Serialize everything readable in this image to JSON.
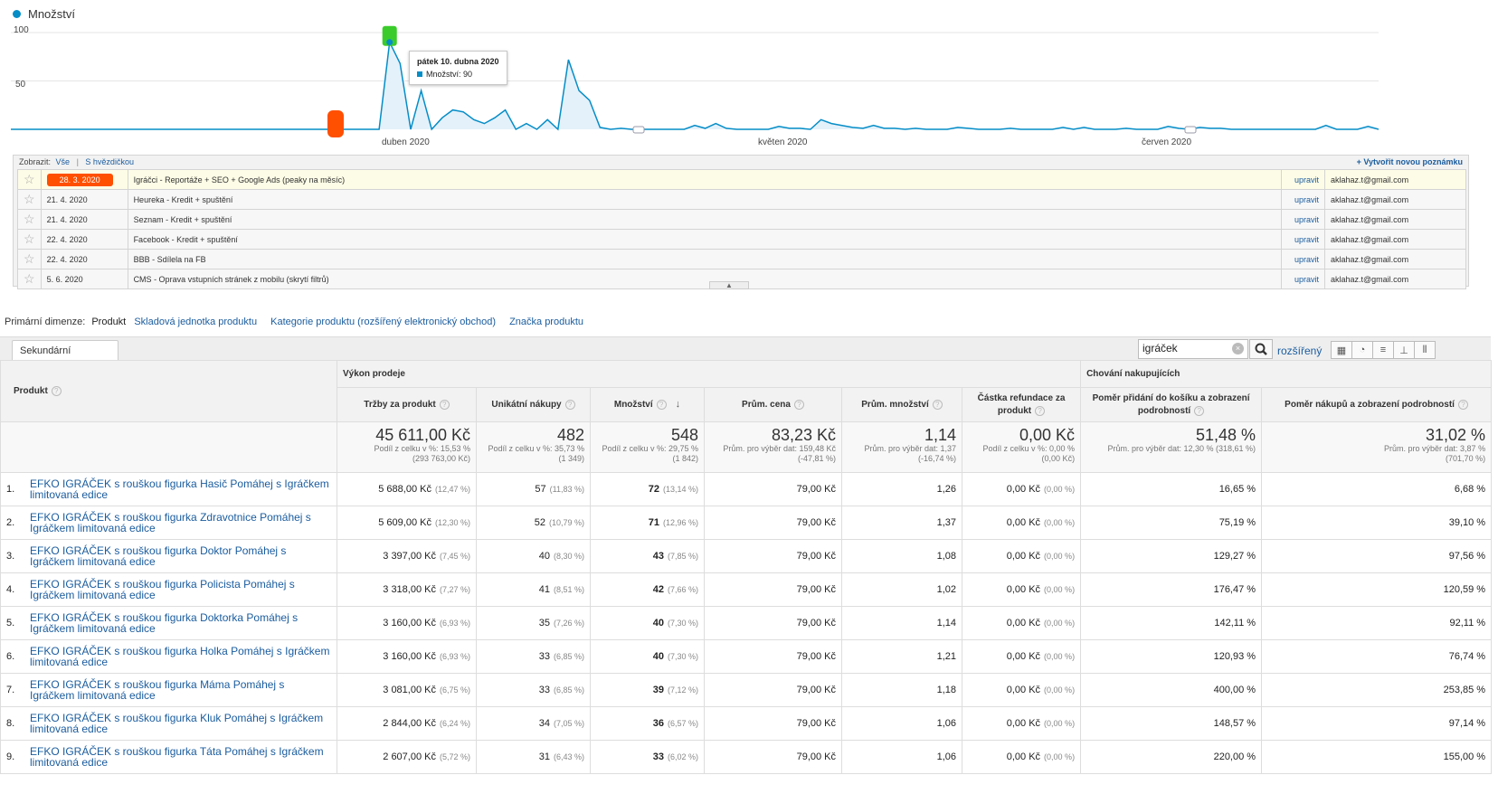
{
  "chart": {
    "legend_label": "Množství",
    "colors": {
      "series": "#058dc7",
      "area": "#e4f1fa",
      "marker_green": "#3bcc2b",
      "marker_orange": "#ff4f00"
    },
    "y_ticks": [
      "100",
      "50"
    ],
    "x_labels": [
      "duben 2020",
      "květen 2020",
      "červen 2020"
    ],
    "tooltip": {
      "date": "pátek 10. dubna 2020",
      "label": "Množství: 90"
    }
  },
  "chart_data": {
    "type": "area",
    "title": "",
    "series": [
      {
        "name": "Množství",
        "values": [
          0,
          0,
          0,
          0,
          0,
          0,
          0,
          0,
          0,
          0,
          0,
          0,
          0,
          0,
          0,
          0,
          0,
          0,
          0,
          0,
          0,
          0,
          0,
          0,
          0,
          0,
          0,
          0,
          0,
          0,
          0,
          0,
          0,
          0,
          0,
          0,
          90,
          68,
          0,
          40,
          0,
          12,
          20,
          18,
          10,
          6,
          12,
          20,
          0,
          6,
          0,
          10,
          0,
          72,
          40,
          30,
          2,
          0,
          1,
          0,
          0,
          0,
          0,
          0,
          0,
          4,
          1,
          6,
          1,
          0,
          0,
          0,
          0,
          3,
          1,
          1,
          0,
          10,
          6,
          4,
          2,
          1,
          4,
          1,
          1,
          0,
          1,
          0,
          0,
          0,
          2,
          1,
          0,
          0,
          0,
          1,
          0,
          0,
          0,
          0,
          2,
          0,
          2,
          0,
          0,
          0,
          1,
          0,
          0,
          0,
          3,
          1,
          0,
          2,
          1,
          1,
          0,
          0,
          0,
          0,
          0,
          0,
          0,
          0,
          0,
          4,
          0,
          0,
          0,
          3,
          0
        ],
        "x_range": [
          "2020-03-02",
          "2020-07-06"
        ]
      }
    ],
    "ylim": [
      0,
      100
    ],
    "grid": true
  },
  "annotations": {
    "show_label": "Zobrazit:",
    "all_link": "Vše",
    "separator": "|",
    "starred_link": "S hvězdičkou",
    "create_link": "+ Vytvořit novou poznámku",
    "edit_label": "upravit",
    "star_glyph": "☆",
    "rows": [
      {
        "date": "28. 3. 2020",
        "text": "Igráčci - Reportáže + SEO + Google Ads (peaky na měsíc)",
        "email": "aklahaz.t@gmail.com"
      },
      {
        "date": "21. 4. 2020",
        "text": "Heureka - Kredit + spuštění",
        "email": "aklahaz.t@gmail.com"
      },
      {
        "date": "21. 4. 2020",
        "text": "Seznam - Kredit + spuštění",
        "email": "aklahaz.t@gmail.com"
      },
      {
        "date": "22. 4. 2020",
        "text": "Facebook - Kredit + spuštění",
        "email": "aklahaz.t@gmail.com"
      },
      {
        "date": "22. 4. 2020",
        "text": "BBB - Sdílela na FB",
        "email": "aklahaz.t@gmail.com"
      },
      {
        "date": "5. 6. 2020",
        "text": "CMS - Oprava vstupních stránek z mobilu (skrytí filtrů)",
        "email": "aklahaz.t@gmail.com"
      }
    ]
  },
  "dimensions": {
    "label": "Primární dimenze:",
    "current": "Produkt",
    "links": [
      "Skladová jednotka produktu",
      "Kategorie produktu (rozšířený elektronický obchod)",
      "Značka produktu"
    ]
  },
  "toolbar": {
    "secondary_dim": "Sekundární dimenze",
    "search_value": "igráček",
    "advanced": "rozšířený"
  },
  "table": {
    "product_header": "Produkt",
    "groups": [
      "Výkon prodeje",
      "Chování nakupujících"
    ],
    "columns": [
      "Tržby za produkt",
      "Unikátní nákupy",
      "Množství",
      "Prům. cena",
      "Prům. množství",
      "Částka refundace za produkt",
      "Poměr přidání do košíku a zobrazení podrobností",
      "Poměr nákupů a zobrazení podrobností"
    ],
    "totals": [
      {
        "value": "45 611,00 Kč",
        "l1": "Podíl z celku v %: 15,53 %",
        "l2": "(293 763,00 Kč)"
      },
      {
        "value": "482",
        "l1": "Podíl z celku v %: 35,73 %",
        "l2": "(1 349)"
      },
      {
        "value": "548",
        "l1": "Podíl z celku v %: 29,75 %",
        "l2": "(1 842)"
      },
      {
        "value": "83,23 Kč",
        "l1": "Prům. pro výběr dat: 159,48 Kč",
        "l2": "(-47,81 %)"
      },
      {
        "value": "1,14",
        "l1": "Prům. pro výběr dat: 1,37",
        "l2": "(-16,74 %)"
      },
      {
        "value": "0,00 Kč",
        "l1": "Podíl z celku v %: 0,00 %",
        "l2": "(0,00 Kč)"
      },
      {
        "value": "51,48 %",
        "l1": "Prům. pro výběr dat: 12,30 % (318,61 %)",
        "l2": ""
      },
      {
        "value": "31,02 %",
        "l1": "Prům. pro výběr dat: 3,87 %",
        "l2": "(701,70 %)"
      }
    ],
    "rows": [
      {
        "n": "1.",
        "product": "EFKO IGRÁČEK s rouškou figurka Hasič Pomáhej s Igráčkem limitovaná edice",
        "rev": "5 688,00 Kč",
        "rev_p": "(12,47 %)",
        "uniq": "57",
        "uniq_p": "(11,83 %)",
        "qty": "72",
        "qty_p": "(13,14 %)",
        "price": "79,00 Kč",
        "avgq": "1,26",
        "ref": "0,00 Kč",
        "ref_p": "(0,00 %)",
        "cart": "16,65 %",
        "buy": "6,68 %"
      },
      {
        "n": "2.",
        "product": "EFKO IGRÁČEK s rouškou figurka Zdravotnice Pomáhej s Igráčkem limitovaná edice",
        "rev": "5 609,00 Kč",
        "rev_p": "(12,30 %)",
        "uniq": "52",
        "uniq_p": "(10,79 %)",
        "qty": "71",
        "qty_p": "(12,96 %)",
        "price": "79,00 Kč",
        "avgq": "1,37",
        "ref": "0,00 Kč",
        "ref_p": "(0,00 %)",
        "cart": "75,19 %",
        "buy": "39,10 %"
      },
      {
        "n": "3.",
        "product": "EFKO IGRÁČEK s rouškou figurka Doktor Pomáhej s Igráčkem limitovaná edice",
        "rev": "3 397,00 Kč",
        "rev_p": "(7,45 %)",
        "uniq": "40",
        "uniq_p": "(8,30 %)",
        "qty": "43",
        "qty_p": "(7,85 %)",
        "price": "79,00 Kč",
        "avgq": "1,08",
        "ref": "0,00 Kč",
        "ref_p": "(0,00 %)",
        "cart": "129,27 %",
        "buy": "97,56 %"
      },
      {
        "n": "4.",
        "product": "EFKO IGRÁČEK s rouškou figurka Policista Pomáhej s Igráčkem limitovaná edice",
        "rev": "3 318,00 Kč",
        "rev_p": "(7,27 %)",
        "uniq": "41",
        "uniq_p": "(8,51 %)",
        "qty": "42",
        "qty_p": "(7,66 %)",
        "price": "79,00 Kč",
        "avgq": "1,02",
        "ref": "0,00 Kč",
        "ref_p": "(0,00 %)",
        "cart": "176,47 %",
        "buy": "120,59 %"
      },
      {
        "n": "5.",
        "product": "EFKO IGRÁČEK s rouškou figurka Doktorka Pomáhej s Igráčkem limitovaná edice",
        "rev": "3 160,00 Kč",
        "rev_p": "(6,93 %)",
        "uniq": "35",
        "uniq_p": "(7,26 %)",
        "qty": "40",
        "qty_p": "(7,30 %)",
        "price": "79,00 Kč",
        "avgq": "1,14",
        "ref": "0,00 Kč",
        "ref_p": "(0,00 %)",
        "cart": "142,11 %",
        "buy": "92,11 %"
      },
      {
        "n": "6.",
        "product": "EFKO IGRÁČEK s rouškou figurka Holka Pomáhej s Igráčkem limitovaná edice",
        "rev": "3 160,00 Kč",
        "rev_p": "(6,93 %)",
        "uniq": "33",
        "uniq_p": "(6,85 %)",
        "qty": "40",
        "qty_p": "(7,30 %)",
        "price": "79,00 Kč",
        "avgq": "1,21",
        "ref": "0,00 Kč",
        "ref_p": "(0,00 %)",
        "cart": "120,93 %",
        "buy": "76,74 %"
      },
      {
        "n": "7.",
        "product": "EFKO IGRÁČEK s rouškou figurka Máma Pomáhej s Igráčkem limitovaná edice",
        "rev": "3 081,00 Kč",
        "rev_p": "(6,75 %)",
        "uniq": "33",
        "uniq_p": "(6,85 %)",
        "qty": "39",
        "qty_p": "(7,12 %)",
        "price": "79,00 Kč",
        "avgq": "1,18",
        "ref": "0,00 Kč",
        "ref_p": "(0,00 %)",
        "cart": "400,00 %",
        "buy": "253,85 %"
      },
      {
        "n": "8.",
        "product": "EFKO IGRÁČEK s rouškou figurka Kluk Pomáhej s Igráčkem limitovaná edice",
        "rev": "2 844,00 Kč",
        "rev_p": "(6,24 %)",
        "uniq": "34",
        "uniq_p": "(7,05 %)",
        "qty": "36",
        "qty_p": "(6,57 %)",
        "price": "79,00 Kč",
        "avgq": "1,06",
        "ref": "0,00 Kč",
        "ref_p": "(0,00 %)",
        "cart": "148,57 %",
        "buy": "97,14 %"
      },
      {
        "n": "9.",
        "product": "EFKO IGRÁČEK s rouškou figurka Táta Pomáhej s Igráčkem limitovaná edice",
        "rev": "2 607,00 Kč",
        "rev_p": "(5,72 %)",
        "uniq": "31",
        "uniq_p": "(6,43 %)",
        "qty": "33",
        "qty_p": "(6,02 %)",
        "price": "79,00 Kč",
        "avgq": "1,06",
        "ref": "0,00 Kč",
        "ref_p": "(0,00 %)",
        "cart": "220,00 %",
        "buy": "155,00 %"
      }
    ]
  }
}
